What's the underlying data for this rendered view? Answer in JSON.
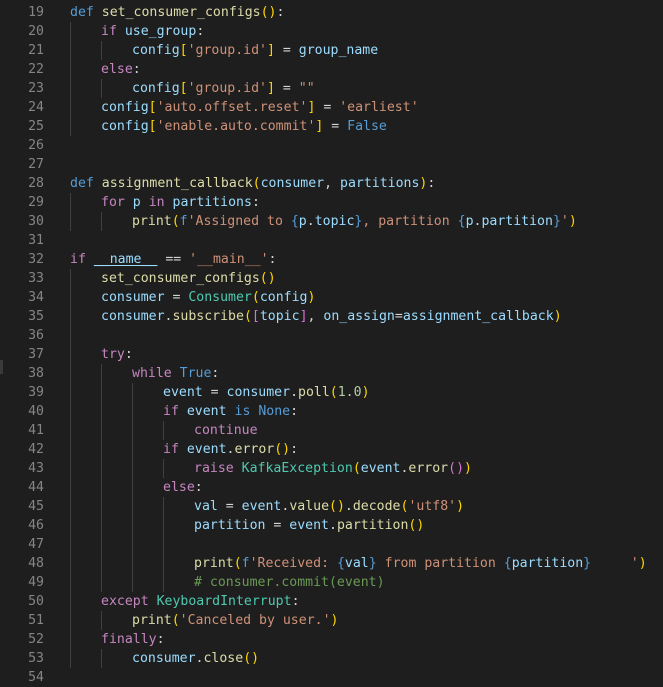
{
  "editor": {
    "lines": [
      {
        "n": "19",
        "indent": 0,
        "tokens": [
          [
            "kw",
            "def"
          ],
          [
            "op",
            " "
          ],
          [
            "fn",
            "set_consumer_configs"
          ],
          [
            "b1",
            "()"
          ],
          [
            "op",
            ":"
          ]
        ]
      },
      {
        "n": "20",
        "indent": 1,
        "tokens": [
          [
            "ctl",
            "if"
          ],
          [
            "op",
            " "
          ],
          [
            "var",
            "use_group"
          ],
          [
            "op",
            ":"
          ]
        ]
      },
      {
        "n": "21",
        "indent": 2,
        "tokens": [
          [
            "var",
            "config"
          ],
          [
            "b1",
            "["
          ],
          [
            "str",
            "'group.id'"
          ],
          [
            "b1",
            "]"
          ],
          [
            "op",
            " = "
          ],
          [
            "var",
            "group_name"
          ]
        ]
      },
      {
        "n": "22",
        "indent": 1,
        "tokens": [
          [
            "ctl",
            "else"
          ],
          [
            "op",
            ":"
          ]
        ]
      },
      {
        "n": "23",
        "indent": 2,
        "tokens": [
          [
            "var",
            "config"
          ],
          [
            "b1",
            "["
          ],
          [
            "str",
            "'group.id'"
          ],
          [
            "b1",
            "]"
          ],
          [
            "op",
            " = "
          ],
          [
            "str",
            "\"\""
          ]
        ]
      },
      {
        "n": "24",
        "indent": 1,
        "tokens": [
          [
            "var",
            "config"
          ],
          [
            "b1",
            "["
          ],
          [
            "str",
            "'auto.offset.reset'"
          ],
          [
            "b1",
            "]"
          ],
          [
            "op",
            " = "
          ],
          [
            "str",
            "'earliest'"
          ]
        ]
      },
      {
        "n": "25",
        "indent": 1,
        "tokens": [
          [
            "var",
            "config"
          ],
          [
            "b1",
            "["
          ],
          [
            "str",
            "'enable.auto.commit'"
          ],
          [
            "b1",
            "]"
          ],
          [
            "op",
            " = "
          ],
          [
            "kw",
            "False"
          ]
        ]
      },
      {
        "n": "26",
        "indent": 0,
        "tokens": []
      },
      {
        "n": "27",
        "indent": 0,
        "tokens": []
      },
      {
        "n": "28",
        "indent": 0,
        "tokens": [
          [
            "kw",
            "def"
          ],
          [
            "op",
            " "
          ],
          [
            "fn",
            "assignment_callback"
          ],
          [
            "b1",
            "("
          ],
          [
            "var",
            "consumer"
          ],
          [
            "op",
            ", "
          ],
          [
            "var",
            "partitions"
          ],
          [
            "b1",
            ")"
          ],
          [
            "op",
            ":"
          ]
        ]
      },
      {
        "n": "29",
        "indent": 1,
        "tokens": [
          [
            "ctl",
            "for"
          ],
          [
            "op",
            " "
          ],
          [
            "var",
            "p"
          ],
          [
            "op",
            " "
          ],
          [
            "ctl",
            "in"
          ],
          [
            "op",
            " "
          ],
          [
            "var",
            "partitions"
          ],
          [
            "op",
            ":"
          ]
        ]
      },
      {
        "n": "30",
        "indent": 2,
        "tokens": [
          [
            "fn",
            "print"
          ],
          [
            "b1",
            "("
          ],
          [
            "kw",
            "f"
          ],
          [
            "str",
            "'Assigned to "
          ],
          [
            "kw",
            "{"
          ],
          [
            "var",
            "p"
          ],
          [
            "op",
            "."
          ],
          [
            "var",
            "topic"
          ],
          [
            "kw",
            "}"
          ],
          [
            "str",
            ", partition "
          ],
          [
            "kw",
            "{"
          ],
          [
            "var",
            "p"
          ],
          [
            "op",
            "."
          ],
          [
            "var",
            "partition"
          ],
          [
            "kw",
            "}"
          ],
          [
            "str",
            "'"
          ],
          [
            "b1",
            ")"
          ]
        ]
      },
      {
        "n": "31",
        "indent": 0,
        "tokens": []
      },
      {
        "n": "32",
        "indent": 0,
        "tokens": [
          [
            "ctl",
            "if"
          ],
          [
            "op",
            " "
          ],
          [
            "var dunder",
            "__name__"
          ],
          [
            "op",
            " == "
          ],
          [
            "str",
            "'__main__'"
          ],
          [
            "op",
            ":"
          ]
        ]
      },
      {
        "n": "33",
        "indent": 1,
        "tokens": [
          [
            "fn",
            "set_consumer_configs"
          ],
          [
            "b1",
            "()"
          ]
        ]
      },
      {
        "n": "34",
        "indent": 1,
        "tokens": [
          [
            "var",
            "consumer"
          ],
          [
            "op",
            " = "
          ],
          [
            "cls",
            "Consumer"
          ],
          [
            "b1",
            "("
          ],
          [
            "var",
            "config"
          ],
          [
            "b1",
            ")"
          ]
        ]
      },
      {
        "n": "35",
        "indent": 1,
        "tokens": [
          [
            "var",
            "consumer"
          ],
          [
            "op",
            "."
          ],
          [
            "fn",
            "subscribe"
          ],
          [
            "b1",
            "("
          ],
          [
            "b2",
            "["
          ],
          [
            "var",
            "topic"
          ],
          [
            "b2",
            "]"
          ],
          [
            "op",
            ", "
          ],
          [
            "var",
            "on_assign"
          ],
          [
            "op",
            "="
          ],
          [
            "var",
            "assignment_callback"
          ],
          [
            "b1",
            ")"
          ]
        ]
      },
      {
        "n": "36",
        "indent": 1,
        "tokens": []
      },
      {
        "n": "37",
        "indent": 1,
        "tokens": [
          [
            "ctl",
            "try"
          ],
          [
            "op",
            ":"
          ]
        ]
      },
      {
        "n": "38",
        "indent": 2,
        "tokens": [
          [
            "ctl",
            "while"
          ],
          [
            "op",
            " "
          ],
          [
            "kw",
            "True"
          ],
          [
            "op",
            ":"
          ]
        ]
      },
      {
        "n": "39",
        "indent": 3,
        "tokens": [
          [
            "var",
            "event"
          ],
          [
            "op",
            " = "
          ],
          [
            "var",
            "consumer"
          ],
          [
            "op",
            "."
          ],
          [
            "fn",
            "poll"
          ],
          [
            "b1",
            "("
          ],
          [
            "num",
            "1.0"
          ],
          [
            "b1",
            ")"
          ]
        ]
      },
      {
        "n": "40",
        "indent": 3,
        "tokens": [
          [
            "ctl",
            "if"
          ],
          [
            "op",
            " "
          ],
          [
            "var",
            "event"
          ],
          [
            "op",
            " "
          ],
          [
            "kw",
            "is"
          ],
          [
            "op",
            " "
          ],
          [
            "kw",
            "None"
          ],
          [
            "op",
            ":"
          ]
        ]
      },
      {
        "n": "41",
        "indent": 4,
        "tokens": [
          [
            "ctl",
            "continue"
          ]
        ]
      },
      {
        "n": "42",
        "indent": 3,
        "tokens": [
          [
            "ctl",
            "if"
          ],
          [
            "op",
            " "
          ],
          [
            "var",
            "event"
          ],
          [
            "op",
            "."
          ],
          [
            "fn",
            "error"
          ],
          [
            "b1",
            "()"
          ],
          [
            "op",
            ":"
          ]
        ]
      },
      {
        "n": "43",
        "indent": 4,
        "tokens": [
          [
            "ctl",
            "raise"
          ],
          [
            "op",
            " "
          ],
          [
            "cls",
            "KafkaException"
          ],
          [
            "b1",
            "("
          ],
          [
            "var",
            "event"
          ],
          [
            "op",
            "."
          ],
          [
            "fn",
            "error"
          ],
          [
            "b2",
            "()"
          ],
          [
            "b1",
            ")"
          ]
        ]
      },
      {
        "n": "44",
        "indent": 3,
        "tokens": [
          [
            "ctl",
            "else"
          ],
          [
            "op",
            ":"
          ]
        ]
      },
      {
        "n": "45",
        "indent": 4,
        "tokens": [
          [
            "var",
            "val"
          ],
          [
            "op",
            " = "
          ],
          [
            "var",
            "event"
          ],
          [
            "op",
            "."
          ],
          [
            "fn",
            "value"
          ],
          [
            "b1",
            "()"
          ],
          [
            "op",
            "."
          ],
          [
            "fn",
            "decode"
          ],
          [
            "b1",
            "("
          ],
          [
            "str",
            "'utf8'"
          ],
          [
            "b1",
            ")"
          ]
        ]
      },
      {
        "n": "46",
        "indent": 4,
        "tokens": [
          [
            "var",
            "partition"
          ],
          [
            "op",
            " = "
          ],
          [
            "var",
            "event"
          ],
          [
            "op",
            "."
          ],
          [
            "fn",
            "partition"
          ],
          [
            "b1",
            "()"
          ]
        ]
      },
      {
        "n": "47",
        "indent": 4,
        "tokens": []
      },
      {
        "n": "48",
        "indent": 4,
        "tokens": [
          [
            "fn",
            "print"
          ],
          [
            "b1",
            "("
          ],
          [
            "kw",
            "f"
          ],
          [
            "str",
            "'Received: "
          ],
          [
            "kw",
            "{"
          ],
          [
            "var",
            "val"
          ],
          [
            "kw",
            "}"
          ],
          [
            "str",
            " from partition "
          ],
          [
            "kw",
            "{"
          ],
          [
            "var",
            "partition"
          ],
          [
            "kw",
            "}"
          ],
          [
            "str",
            "     '"
          ],
          [
            "b1",
            ")"
          ]
        ]
      },
      {
        "n": "49",
        "indent": 4,
        "tokens": [
          [
            "cmt",
            "# consumer.commit(event)"
          ]
        ]
      },
      {
        "n": "50",
        "indent": 1,
        "tokens": [
          [
            "ctl",
            "except"
          ],
          [
            "op",
            " "
          ],
          [
            "cls",
            "KeyboardInterrupt"
          ],
          [
            "op",
            ":"
          ]
        ]
      },
      {
        "n": "51",
        "indent": 2,
        "tokens": [
          [
            "fn",
            "print"
          ],
          [
            "b1",
            "("
          ],
          [
            "str",
            "'Canceled by user.'"
          ],
          [
            "b1",
            ")"
          ]
        ]
      },
      {
        "n": "52",
        "indent": 1,
        "tokens": [
          [
            "ctl",
            "finally"
          ],
          [
            "op",
            ":"
          ]
        ]
      },
      {
        "n": "53",
        "indent": 2,
        "tokens": [
          [
            "var",
            "consumer"
          ],
          [
            "op",
            "."
          ],
          [
            "fn",
            "close"
          ],
          [
            "b1",
            "()"
          ]
        ]
      },
      {
        "n": "54",
        "indent": 0,
        "tokens": []
      }
    ]
  }
}
